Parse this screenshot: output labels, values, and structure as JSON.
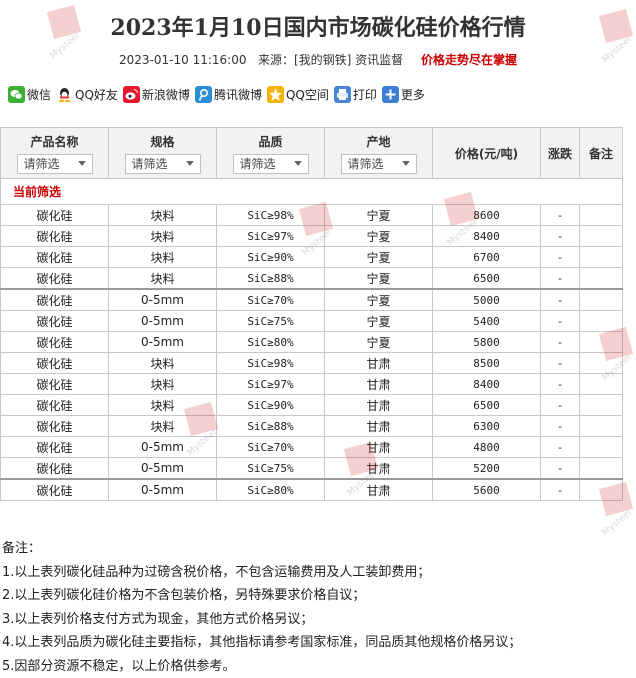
{
  "header": {
    "title": "2023年1月10日国内市场碳化硅价格行情",
    "datetime": "2023-01-10 11:16:00",
    "source": "来源：[我的钢铁] 资讯监督",
    "slogan": "价格走势尽在掌握"
  },
  "share": [
    {
      "icon": "wechat-icon",
      "label": "微信",
      "color": "#3cb034"
    },
    {
      "icon": "qq-friend-icon",
      "label": "QQ好友",
      "color": "#1e8fe0"
    },
    {
      "icon": "weibo-icon",
      "label": "新浪微博",
      "color": "#e6162d"
    },
    {
      "icon": "tencent-weibo-icon",
      "label": "腾讯微博",
      "color": "#2a8fd8"
    },
    {
      "icon": "qzone-icon",
      "label": "QQ空间",
      "color": "#f5b400"
    },
    {
      "icon": "print-icon",
      "label": "打印",
      "color": "#4a86d4"
    },
    {
      "icon": "more-icon",
      "label": "更多",
      "color": "#3d7fd8"
    }
  ],
  "table": {
    "headers": {
      "name": "产品名称",
      "spec": "规格",
      "quality": "品质",
      "origin": "产地",
      "price": "价格(元/吨)",
      "change": "涨跌",
      "remark": "备注"
    },
    "filter_placeholder": "请筛选",
    "current_filter_label": "当前筛选",
    "rows": [
      {
        "name": "碳化硅",
        "spec": "块料",
        "quality": "SiC≥98%",
        "origin": "宁夏",
        "price": "8600",
        "change": "-",
        "remark": ""
      },
      {
        "name": "碳化硅",
        "spec": "块料",
        "quality": "SiC≥97%",
        "origin": "宁夏",
        "price": "8400",
        "change": "-",
        "remark": ""
      },
      {
        "name": "碳化硅",
        "spec": "块料",
        "quality": "SiC≥90%",
        "origin": "宁夏",
        "price": "6700",
        "change": "-",
        "remark": ""
      },
      {
        "name": "碳化硅",
        "spec": "块料",
        "quality": "SiC≥88%",
        "origin": "宁夏",
        "price": "6500",
        "change": "-",
        "remark": ""
      },
      {
        "name": "碳化硅",
        "spec": "0-5mm",
        "quality": "SiC≥70%",
        "origin": "宁夏",
        "price": "5000",
        "change": "-",
        "remark": ""
      },
      {
        "name": "碳化硅",
        "spec": "0-5mm",
        "quality": "SiC≥75%",
        "origin": "宁夏",
        "price": "5400",
        "change": "-",
        "remark": ""
      },
      {
        "name": "碳化硅",
        "spec": "0-5mm",
        "quality": "SiC≥80%",
        "origin": "宁夏",
        "price": "5800",
        "change": "-",
        "remark": ""
      },
      {
        "name": "碳化硅",
        "spec": "块料",
        "quality": "SiC≥98%",
        "origin": "甘肃",
        "price": "8500",
        "change": "-",
        "remark": ""
      },
      {
        "name": "碳化硅",
        "spec": "块料",
        "quality": "SiC≥97%",
        "origin": "甘肃",
        "price": "8400",
        "change": "-",
        "remark": ""
      },
      {
        "name": "碳化硅",
        "spec": "块料",
        "quality": "SiC≥90%",
        "origin": "甘肃",
        "price": "6500",
        "change": "-",
        "remark": ""
      },
      {
        "name": "碳化硅",
        "spec": "块料",
        "quality": "SiC≥88%",
        "origin": "甘肃",
        "price": "6300",
        "change": "-",
        "remark": ""
      },
      {
        "name": "碳化硅",
        "spec": "0-5mm",
        "quality": "SiC≥70%",
        "origin": "甘肃",
        "price": "4800",
        "change": "-",
        "remark": ""
      },
      {
        "name": "碳化硅",
        "spec": "0-5mm",
        "quality": "SiC≥75%",
        "origin": "甘肃",
        "price": "5200",
        "change": "-",
        "remark": ""
      },
      {
        "name": "碳化硅",
        "spec": "0-5mm",
        "quality": "SiC≥80%",
        "origin": "甘肃",
        "price": "5600",
        "change": "-",
        "remark": ""
      }
    ]
  },
  "notes": {
    "heading": "备注：",
    "items": [
      "1.以上表列碳化硅品种为过磅含税价格，不包含运输费用及人工装卸费用；",
      "2.以上表列碳化硅价格为不含包装价格，另特殊要求价格自议；",
      "3.以上表列价格支付方式为现金，其他方式价格另议；",
      "4.以上表列品质为碳化硅主要指标，其他指标请参考国家标准，同品质其他规格价格另议；",
      "5.因部分资源不稳定，以上价格供参考。"
    ]
  },
  "watermark": {
    "text": "Mysteel",
    "color": "#cc0000"
  }
}
